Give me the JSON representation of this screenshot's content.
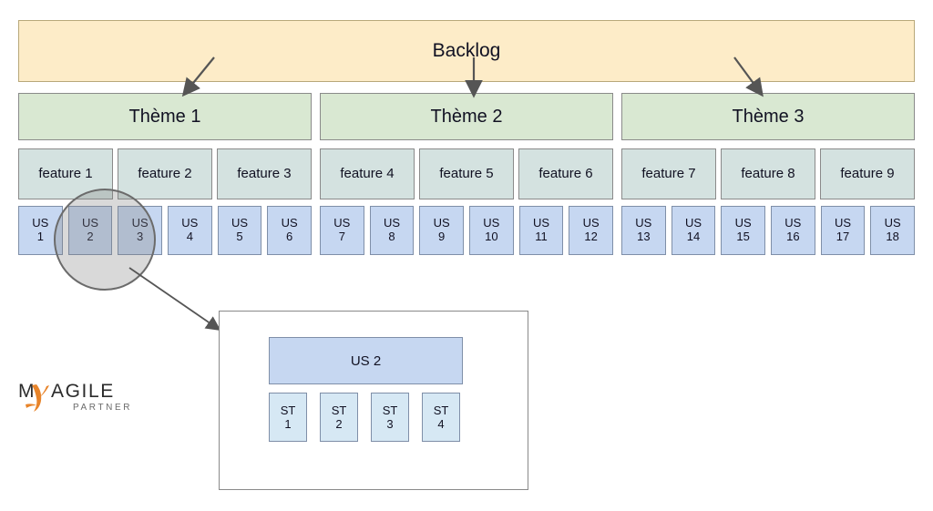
{
  "backlog": {
    "label": "Backlog",
    "fill": "#fdecc8",
    "border": "#b8a87a"
  },
  "themes": [
    {
      "label": "Thème 1"
    },
    {
      "label": "Thème 2"
    },
    {
      "label": "Thème 3"
    }
  ],
  "theme_style": {
    "fill": "#d9e8d2",
    "border": "#8a8a8a"
  },
  "features": [
    {
      "label": "feature 1"
    },
    {
      "label": "feature 2"
    },
    {
      "label": "feature 3"
    },
    {
      "label": "feature 4"
    },
    {
      "label": "feature 5"
    },
    {
      "label": "feature 6"
    },
    {
      "label": "feature 7"
    },
    {
      "label": "feature 8"
    },
    {
      "label": "feature 9"
    }
  ],
  "feature_style": {
    "fill": "#d4e2e0",
    "border": "#8a8a8a"
  },
  "user_stories": [
    {
      "prefix": "US",
      "number": "1"
    },
    {
      "prefix": "US",
      "number": "2"
    },
    {
      "prefix": "US",
      "number": "3"
    },
    {
      "prefix": "US",
      "number": "4"
    },
    {
      "prefix": "US",
      "number": "5"
    },
    {
      "prefix": "US",
      "number": "6"
    },
    {
      "prefix": "US",
      "number": "7"
    },
    {
      "prefix": "US",
      "number": "8"
    },
    {
      "prefix": "US",
      "number": "9"
    },
    {
      "prefix": "US",
      "number": "10"
    },
    {
      "prefix": "US",
      "number": "11"
    },
    {
      "prefix": "US",
      "number": "12"
    },
    {
      "prefix": "US",
      "number": "13"
    },
    {
      "prefix": "US",
      "number": "14"
    },
    {
      "prefix": "US",
      "number": "15"
    },
    {
      "prefix": "US",
      "number": "16"
    },
    {
      "prefix": "US",
      "number": "17"
    },
    {
      "prefix": "US",
      "number": "18"
    }
  ],
  "us_style": {
    "fill": "#c6d7f1",
    "border": "#7f8fa8"
  },
  "magnifier": {
    "focus_label": "US 2",
    "tint": "#828282"
  },
  "detail": {
    "us_label": "US 2",
    "tasks": [
      {
        "prefix": "ST",
        "number": "1"
      },
      {
        "prefix": "ST",
        "number": "2"
      },
      {
        "prefix": "ST",
        "number": "3"
      },
      {
        "prefix": "ST",
        "number": "4"
      }
    ],
    "task_fill": "#d6e8f4",
    "panel_border": "#8a8a8a"
  },
  "logo": {
    "text_my": "M",
    "text_agile": "AGILE",
    "text_partner": "PARTNER",
    "accent": "#e8842a",
    "ink": "#2b2b2b"
  },
  "arrows": {
    "color": "#555555",
    "count": 4
  }
}
